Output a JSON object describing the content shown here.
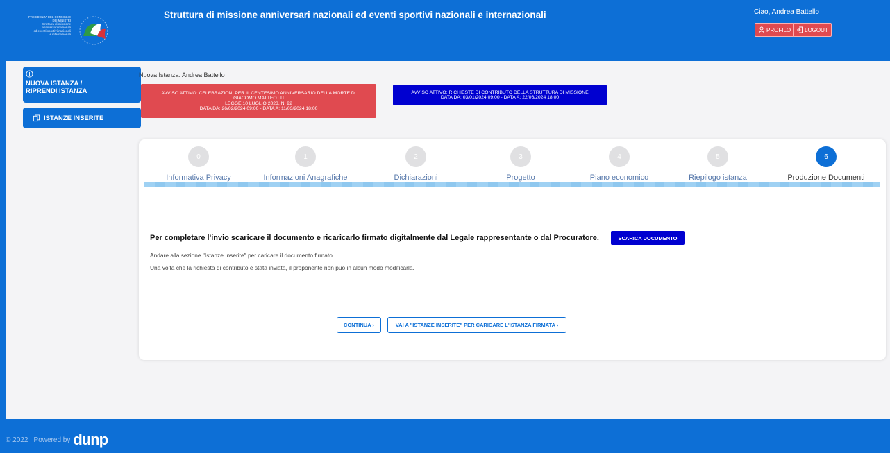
{
  "header": {
    "logo_text": [
      "PRESIDENZA DEL CONSIGLIO",
      "DEI MINISTRI",
      "Struttura di missione",
      "anniversari nazionali",
      "ed eventi sportivi nazionali",
      "e internazionali"
    ],
    "title": "Struttura di missione anniversari nazionali ed eventi sportivi nazionali e internazionali",
    "greeting": "Ciao, Andrea Battello",
    "profile_label": "Profilo",
    "logout_label": "Logout"
  },
  "sidebar": {
    "new_label_1": "NUOVA ISTANZA /",
    "new_label_2": "RIPRENDI ISTANZA",
    "inserted_label": "ISTANZE INSERITE"
  },
  "breadcrumb": "Nuova Istanza: Andrea Battello",
  "notices": {
    "red": [
      "Avviso attivo: Celebrazioni per il centesimo anniversario della morte di",
      "Giacomo Matteotti",
      "Legge 10 luglio 2023, n. 92",
      "Data da: 26/02/2024 09:00 - Data a: 11/03/2024 18:00"
    ],
    "blue": [
      "Avviso attivo: Richieste di contributo della struttura di missione",
      "Data da: 03/01/2024 09:00 - Data a: 22/06/2024 18:00"
    ]
  },
  "steps": [
    {
      "num": "0",
      "label": "Informativa Privacy"
    },
    {
      "num": "1",
      "label": "Informazioni Anagrafiche"
    },
    {
      "num": "2",
      "label": "Dichiarazioni"
    },
    {
      "num": "3",
      "label": "Progetto"
    },
    {
      "num": "4",
      "label": "Piano economico"
    },
    {
      "num": "5",
      "label": "Riepilogo istanza"
    },
    {
      "num": "6",
      "label": "Produzione Documenti"
    }
  ],
  "content": {
    "instruction": "Per completare l'invio scaricare il documento e ricaricarlo firmato digitalmente dal Legale rappresentante o dal Procuratore.",
    "download_label": "Scarica documento",
    "info_1": "Andare alla sezione \"Istanze Inserite\" per caricare il documento firmato",
    "info_2": "Una volta che la richiesta di contributo è stata inviata, il proponente non può in alcun modo modificarla.",
    "continue_label": "Continua ›",
    "goto_label": "Vai a \"Istanze Inserite\" per caricare l'istanza firmata ›"
  },
  "footer": {
    "copyright": "© 2022 | Powered by",
    "brand": "dunp"
  },
  "colors": {
    "primary": "#0d6fd6",
    "alert_red": "#e04a50",
    "deep_blue": "#0000d0"
  }
}
